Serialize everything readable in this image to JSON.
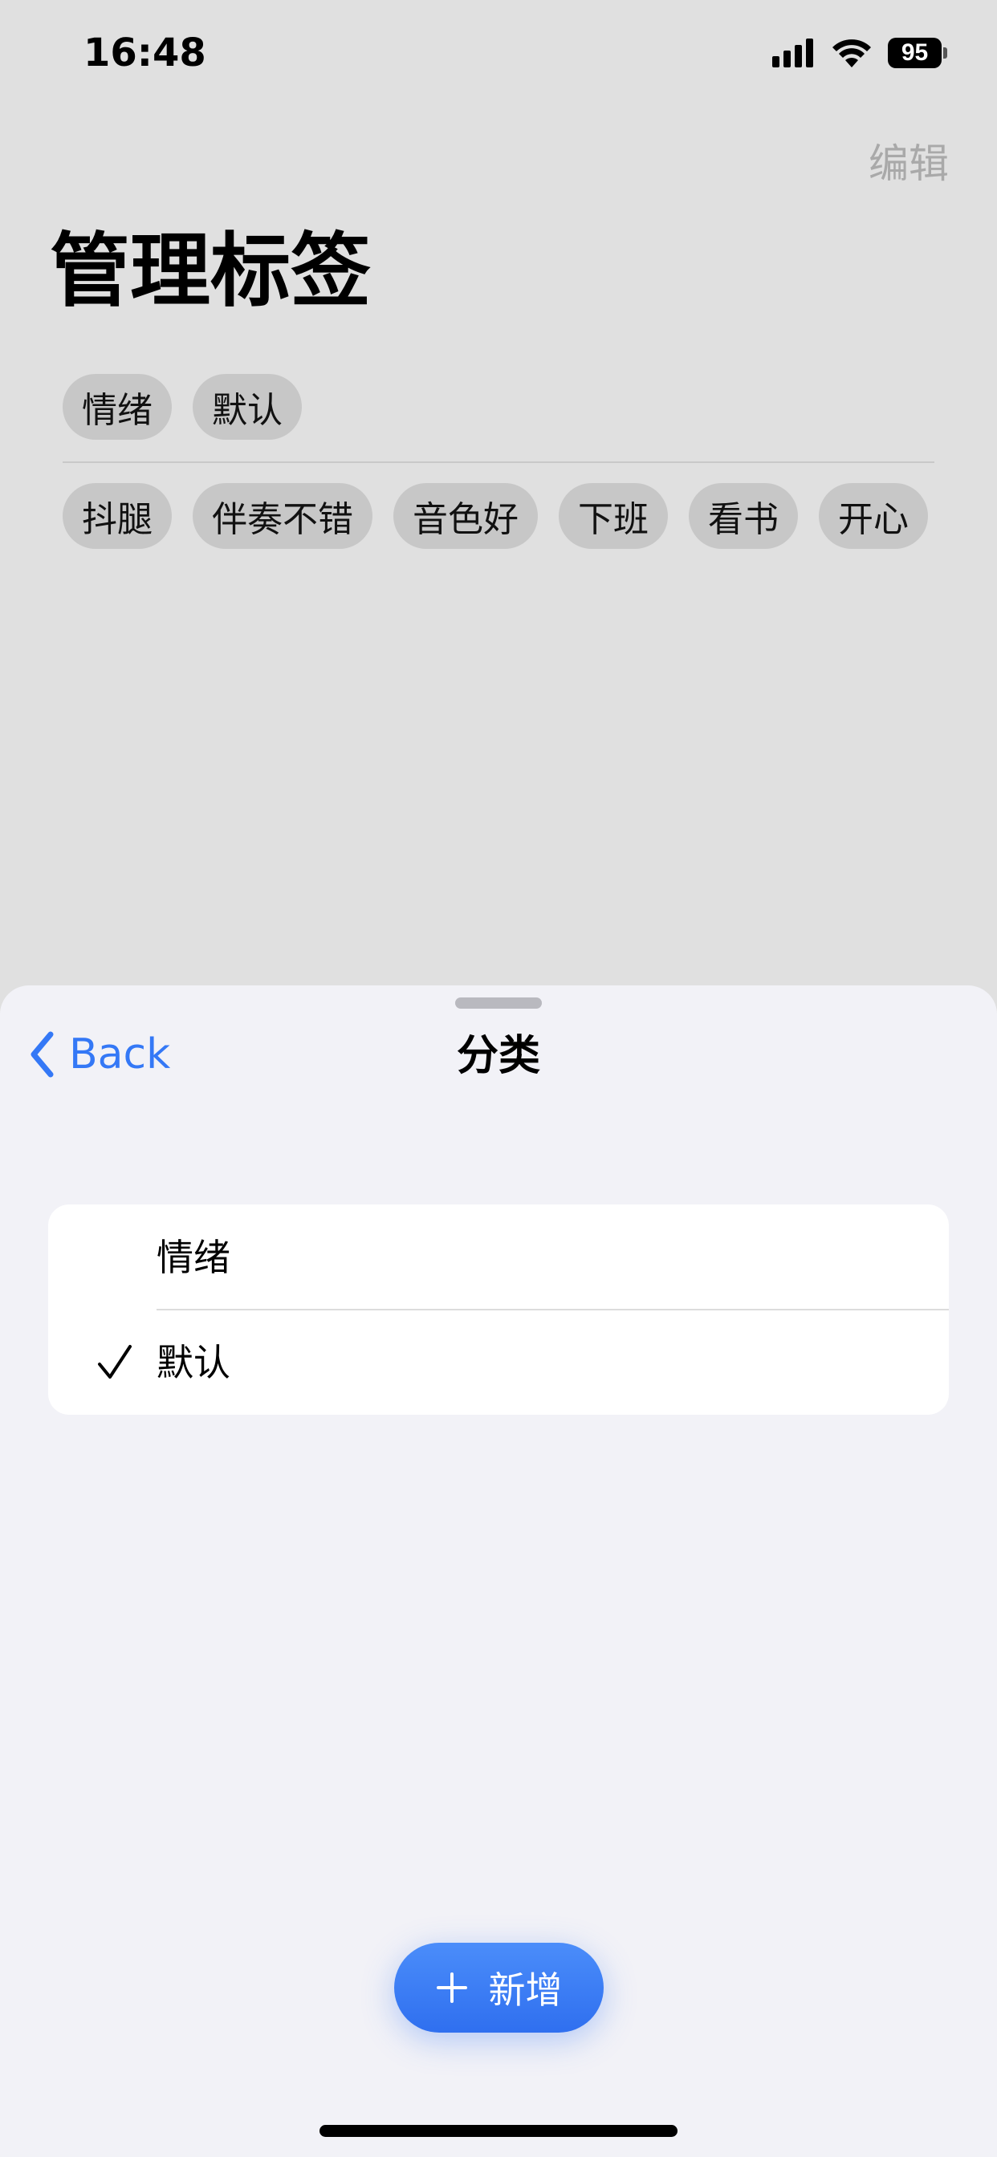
{
  "status_bar": {
    "time": "16:48",
    "battery": "95"
  },
  "background_page": {
    "edit_label": "编辑",
    "title": "管理标签",
    "category_tags": [
      "情绪",
      "默认"
    ],
    "tags": [
      "抖腿",
      "伴奏不错",
      "音色好",
      "下班",
      "看书",
      "开心"
    ]
  },
  "sheet": {
    "back_label": "Back",
    "title": "分类",
    "categories": [
      {
        "label": "情绪",
        "selected": false
      },
      {
        "label": "默认",
        "selected": true
      }
    ],
    "add_label": "新增"
  },
  "colors": {
    "accent": "#3478f6",
    "tag_bg": "#c7c7c7",
    "sheet_bg": "#f2f2f7"
  },
  "icons": {
    "back": "chevron-left-icon",
    "check": "checkmark-icon",
    "add": "plus-icon",
    "signal": "cellular-signal-icon",
    "wifi": "wifi-icon",
    "battery": "battery-icon"
  }
}
